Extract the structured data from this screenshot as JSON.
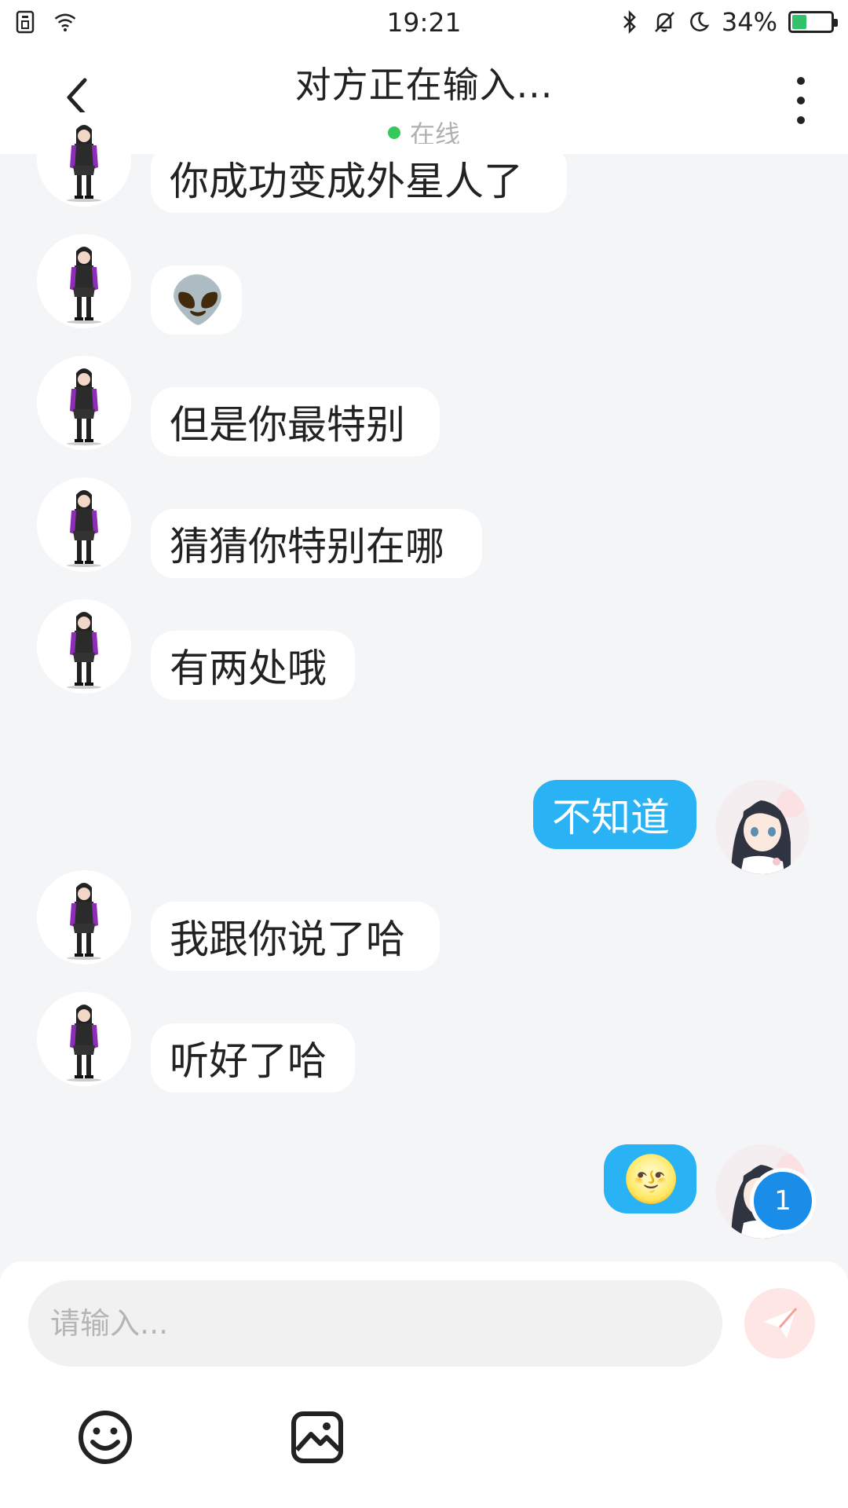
{
  "status_bar": {
    "time": "19:21",
    "battery_percent": "34%",
    "battery_level": 0.34,
    "icons": [
      "sim-icon",
      "wifi-icon",
      "bluetooth-icon",
      "mute-bell-icon",
      "moon-icon",
      "battery-icon"
    ]
  },
  "header": {
    "title": "对方正在输入...",
    "status": "在线",
    "status_color": "#35c95b"
  },
  "messages": [
    {
      "side": "in",
      "text": "你成功变成外星人了"
    },
    {
      "side": "in",
      "text": "👽"
    },
    {
      "side": "in",
      "text": "但是你最特别"
    },
    {
      "side": "in",
      "text": "猜猜你特别在哪"
    },
    {
      "side": "in",
      "text": "有两处哦"
    },
    {
      "side": "out",
      "text": "不知道"
    },
    {
      "side": "in",
      "text": "我跟你说了哈"
    },
    {
      "side": "in",
      "text": "听好了哈"
    },
    {
      "side": "out",
      "text": "🌝",
      "badge": "1"
    }
  ],
  "input": {
    "placeholder": "请输入...",
    "value": ""
  },
  "colors": {
    "outgoing_bubble": "#29b2f4",
    "incoming_bubble": "#ffffff",
    "background": "#f4f5f7",
    "badge": "#1a8de8",
    "send_button": "#f6a098"
  },
  "toolbar": {
    "icons": [
      "smile-icon",
      "image-icon",
      "send-icon"
    ]
  }
}
